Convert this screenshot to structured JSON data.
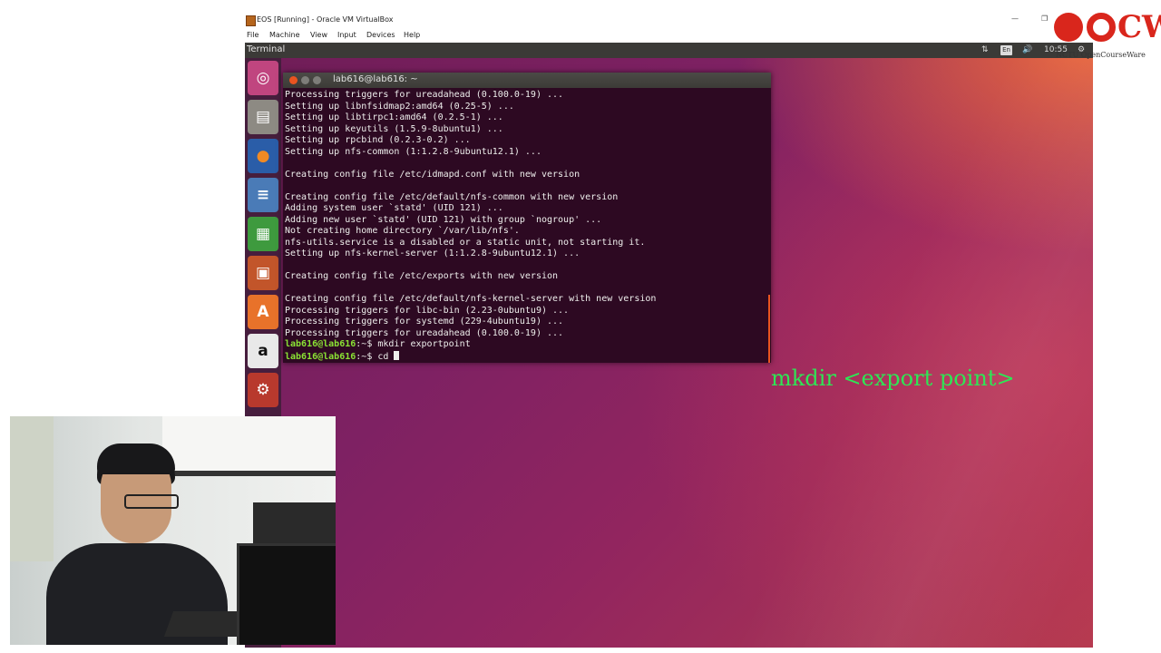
{
  "vbox": {
    "title": "EOS [Running] - Oracle VM VirtualBox",
    "menu": [
      "File",
      "Machine",
      "View",
      "Input",
      "Devices",
      "Help"
    ]
  },
  "topbar": {
    "app_title": "Terminal",
    "keyboard": "En",
    "time": "10:55"
  },
  "launcher": {
    "items": [
      "ubuntu-dash-icon",
      "files-icon",
      "firefox-icon",
      "writer-icon",
      "calc-icon",
      "impress-icon",
      "software-center-icon",
      "amazon-icon",
      "settings-icon"
    ]
  },
  "terminal": {
    "title": "lab616@lab616: ~",
    "lines": [
      {
        "text": "Processing triggers for ureadahead (0.100.0-19) ..."
      },
      {
        "text": "Setting up libnfsidmap2:amd64 (0.25-5) ..."
      },
      {
        "text": "Setting up libtirpc1:amd64 (0.2.5-1) ..."
      },
      {
        "text": "Setting up keyutils (1.5.9-8ubuntu1) ..."
      },
      {
        "text": "Setting up rpcbind (0.2.3-0.2) ..."
      },
      {
        "text": "Setting up nfs-common (1:1.2.8-9ubuntu12.1) ..."
      },
      {
        "text": ""
      },
      {
        "text": "Creating config file /etc/idmapd.conf with new version"
      },
      {
        "text": ""
      },
      {
        "text": "Creating config file /etc/default/nfs-common with new version"
      },
      {
        "text": "Adding system user `statd' (UID 121) ..."
      },
      {
        "text": "Adding new user `statd' (UID 121) with group `nogroup' ..."
      },
      {
        "text": "Not creating home directory `/var/lib/nfs'."
      },
      {
        "text": "nfs-utils.service is a disabled or a static unit, not starting it."
      },
      {
        "text": "Setting up nfs-kernel-server (1:1.2.8-9ubuntu12.1) ..."
      },
      {
        "text": ""
      },
      {
        "text": "Creating config file /etc/exports with new version"
      },
      {
        "text": ""
      },
      {
        "text": "Creating config file /etc/default/nfs-kernel-server with new version"
      },
      {
        "text": "Processing triggers for libc-bin (2.23-0ubuntu9) ..."
      },
      {
        "text": "Processing triggers for systemd (229-4ubuntu19) ..."
      },
      {
        "text": "Processing triggers for ureadahead (0.100.0-19) ..."
      }
    ],
    "prompt1": {
      "user": "lab616@lab616",
      "path": ":~$",
      "cmd": " mkdir exportpoint"
    },
    "prompt2": {
      "user": "lab616@lab616",
      "path": ":~$",
      "cmd": " cd "
    }
  },
  "caption": "mkdir <export point>",
  "logo": {
    "text": "CW",
    "sub": "NCTU OpenCourseWare"
  }
}
